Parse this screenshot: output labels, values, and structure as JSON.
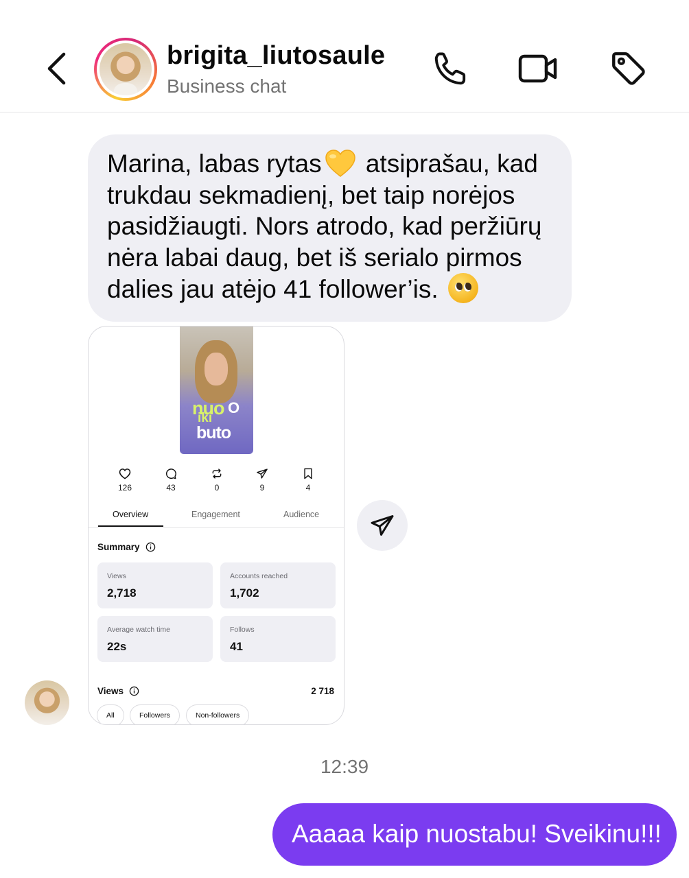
{
  "header": {
    "username": "brigita_liutosaule",
    "subtitle": "Business chat",
    "icons": [
      "back-icon",
      "phone-icon",
      "video-camera-icon",
      "tag-icon"
    ]
  },
  "messages": {
    "incoming_text": {
      "line1_a": "Marina, labas rytas",
      "line1_b": " atsiprašau, kad",
      "line2": "trukdau sekmadienį, bet taip norėjos",
      "line3": "pasidžiaugti. Nors atrodo, kad peržiūrų",
      "line4": "nėra labai daug, bet iš serialo pirmos",
      "line5": "dalies jau atėjo 41 follower’is.",
      "emojis": [
        "yellow-heart",
        "pleading-face"
      ]
    },
    "timestamp": "12:39",
    "outgoing_text": "Aaaaa kaip nuostabu! Sveikinu!!!"
  },
  "shared_screenshot": {
    "stats": [
      {
        "icon": "heart-icon",
        "value": "126"
      },
      {
        "icon": "comment-icon",
        "value": "43"
      },
      {
        "icon": "repost-icon",
        "value": "0"
      },
      {
        "icon": "share-icon",
        "value": "9"
      },
      {
        "icon": "bookmark-icon",
        "value": "4"
      }
    ],
    "tabs": [
      "Overview",
      "Engagement",
      "Audience"
    ],
    "active_tab": "Overview",
    "summary_title": "Summary",
    "cards": [
      {
        "label": "Views",
        "value": "2,718"
      },
      {
        "label": "Accounts reached",
        "value": "1,702"
      },
      {
        "label": "Average watch time",
        "value": "22s"
      },
      {
        "label": "Follows",
        "value": "41"
      }
    ],
    "views_title": "Views",
    "views_total": "2 718",
    "filters": [
      "All",
      "Followers",
      "Non-followers"
    ]
  },
  "colors": {
    "outgoing_bubble": "#7b3cf0",
    "incoming_bubble": "#efeff4",
    "muted_text": "#737373"
  }
}
